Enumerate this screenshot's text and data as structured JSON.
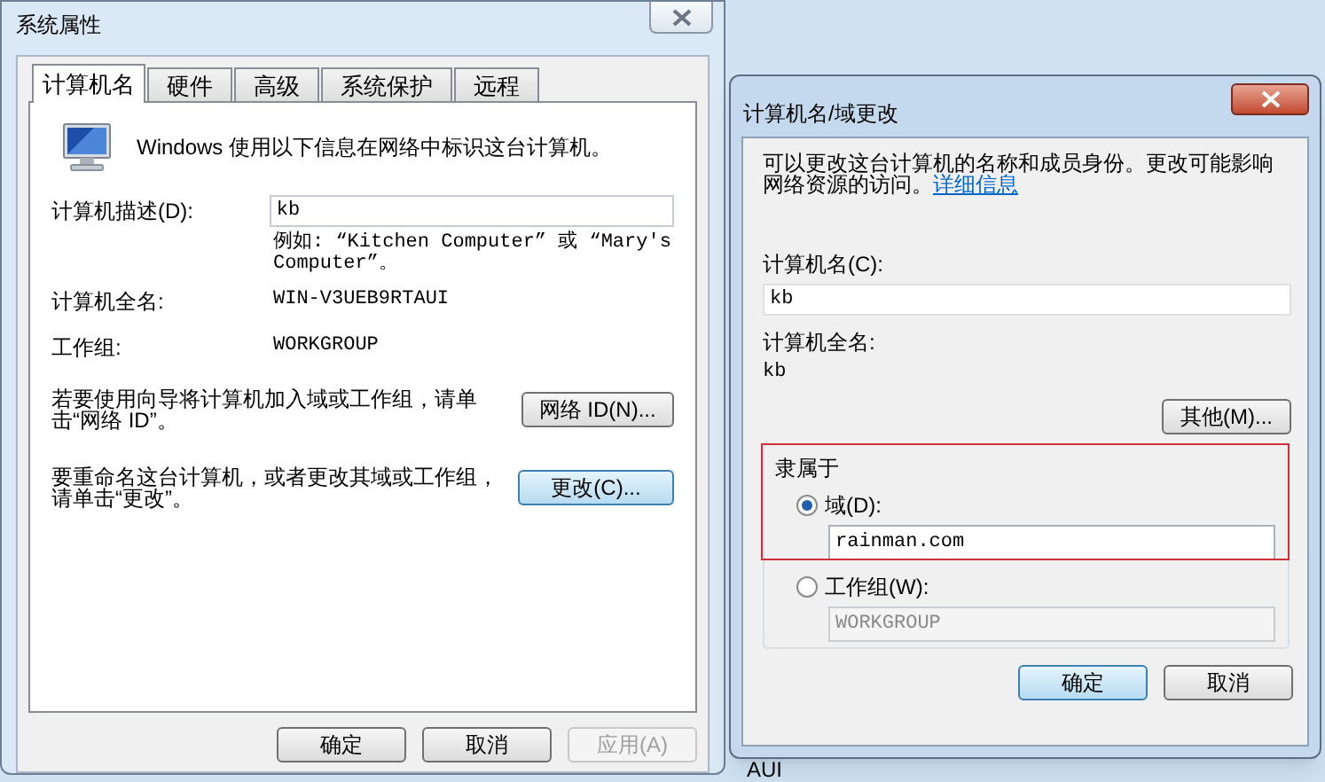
{
  "system_properties": {
    "title": "系统属性",
    "tabs": [
      {
        "label": "计算机名",
        "selected": true
      },
      {
        "label": "硬件",
        "selected": false
      },
      {
        "label": "高级",
        "selected": false
      },
      {
        "label": "系统保护",
        "selected": false
      },
      {
        "label": "远程",
        "selected": false
      }
    ],
    "intro": "Windows 使用以下信息在网络中标识这台计算机。",
    "description_label": "计算机描述(D):",
    "description_value": "kb",
    "example": "例如: “Kitchen Computer” 或 “Mary's Computer”。",
    "full_name_label": "计算机全名:",
    "full_name": "WIN-V3UEB9RTAUI",
    "workgroup_label": "工作组:",
    "workgroup": "WORKGROUP",
    "network_id_text": "若要使用向导将计算机加入域或工作组，请单击“网络 ID”。",
    "network_id_button": "网络 ID(N)...",
    "rename_text": "要重命名这台计算机，或者更改其域或工作组，请单击“更改”。",
    "change_button": "更改(C)...",
    "buttons": [
      {
        "label": "确定",
        "disabled": false
      },
      {
        "label": "取消",
        "disabled": false
      },
      {
        "label": "应用(A)",
        "disabled": true
      }
    ]
  },
  "dialog": {
    "title": "计算机名/域更改",
    "intro": "可以更改这台计算机的名称和成员身份。更改可能影响网络资源的访问。",
    "link": "详细信息",
    "name_label": "计算机名(C):",
    "name_value": "kb",
    "full_name_label": "计算机全名:",
    "full_name": "kb",
    "more_button": "其他(M)...",
    "member_of": "隶属于",
    "options": [
      {
        "label": "域(D):",
        "selected": true,
        "value": "rainman.com"
      },
      {
        "label": "工作组(W):",
        "selected": false,
        "value": "WORKGROUP"
      }
    ],
    "buttons": [
      "确定",
      "取消"
    ]
  },
  "background_text": "AUI"
}
